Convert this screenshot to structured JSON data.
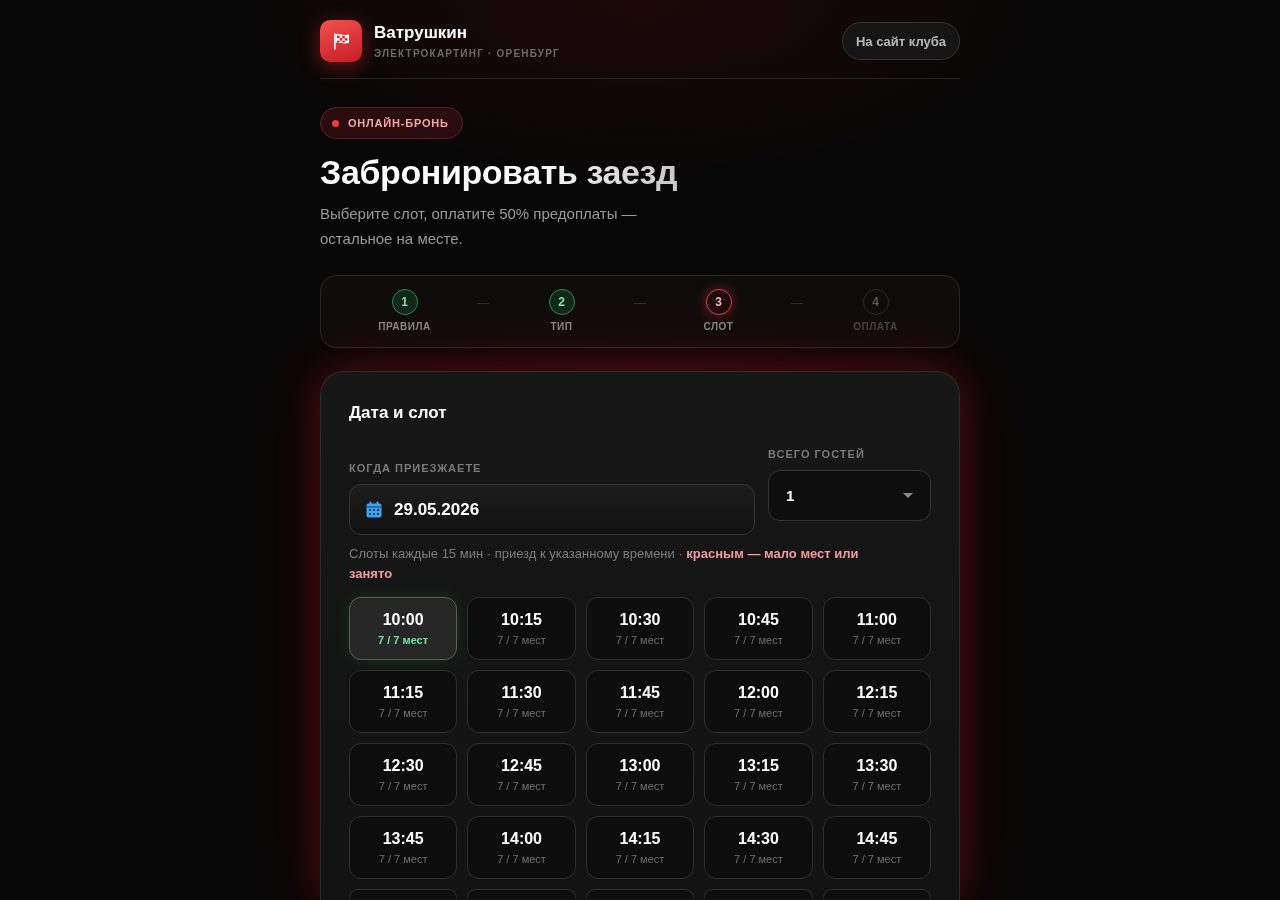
{
  "header": {
    "brand": "Ватрушкин",
    "subtitle": "ЭЛЕКТРОКАРТИНГ · ОРЕНБУРГ",
    "site_button": "На сайт клуба"
  },
  "badge": "ОНЛАЙН-БРОНЬ",
  "title": "Забронировать заезд",
  "lead": "Выберите слот, оплатите 50% предоплаты — остальное на месте.",
  "steps": [
    {
      "number": "1",
      "label": "ПРАВИЛА",
      "completed": true,
      "current": false
    },
    {
      "number": "2",
      "label": "ТИП",
      "completed": true,
      "current": false
    },
    {
      "number": "3",
      "label": "СЛОТ",
      "completed": false,
      "current": true
    },
    {
      "number": "4",
      "label": "ОПЛАТА",
      "completed": false,
      "current": false
    }
  ],
  "booking": {
    "heading": "Дата и слот",
    "date_label": "КОГДА ПРИЕЗЖАЕТЕ",
    "date_value": "29.05.2026",
    "guests_label": "ВСЕГО ГОСТЕЙ",
    "guests_value": "1",
    "hint": "Слоты каждые 15 мин · приезд к указанному времени · **красным — мало мест или занято**",
    "slots": [
      {
        "time": "10:00",
        "seats": "7 / 7 мест",
        "selected": true
      },
      {
        "time": "10:15",
        "seats": "7 / 7 мест",
        "selected": false
      },
      {
        "time": "10:30",
        "seats": "7 / 7 мест",
        "selected": false
      },
      {
        "time": "10:45",
        "seats": "7 / 7 мест",
        "selected": false
      },
      {
        "time": "11:00",
        "seats": "7 / 7 мест",
        "selected": false
      },
      {
        "time": "11:15",
        "seats": "7 / 7 мест",
        "selected": false
      },
      {
        "time": "11:30",
        "seats": "7 / 7 мест",
        "selected": false
      },
      {
        "time": "11:45",
        "seats": "7 / 7 мест",
        "selected": false
      },
      {
        "time": "12:00",
        "seats": "7 / 7 мест",
        "selected": false
      },
      {
        "time": "12:15",
        "seats": "7 / 7 мест",
        "selected": false
      },
      {
        "time": "12:30",
        "seats": "7 / 7 мест",
        "selected": false
      },
      {
        "time": "12:45",
        "seats": "7 / 7 мест",
        "selected": false
      },
      {
        "time": "13:00",
        "seats": "7 / 7 мест",
        "selected": false
      },
      {
        "time": "13:15",
        "seats": "7 / 7 мест",
        "selected": false
      },
      {
        "time": "13:30",
        "seats": "7 / 7 мест",
        "selected": false
      },
      {
        "time": "13:45",
        "seats": "7 / 7 мест",
        "selected": false
      },
      {
        "time": "14:00",
        "seats": "7 / 7 мест",
        "selected": false
      },
      {
        "time": "14:15",
        "seats": "7 / 7 мест",
        "selected": false
      },
      {
        "time": "14:30",
        "seats": "7 / 7 мест",
        "selected": false
      },
      {
        "time": "14:45",
        "seats": "7 / 7 мест",
        "selected": false
      },
      {
        "selected": false
      },
      {
        "selected": false
      },
      {
        "selected": false
      },
      {
        "selected": false
      },
      {
        "selected": false
      }
    ]
  }
}
